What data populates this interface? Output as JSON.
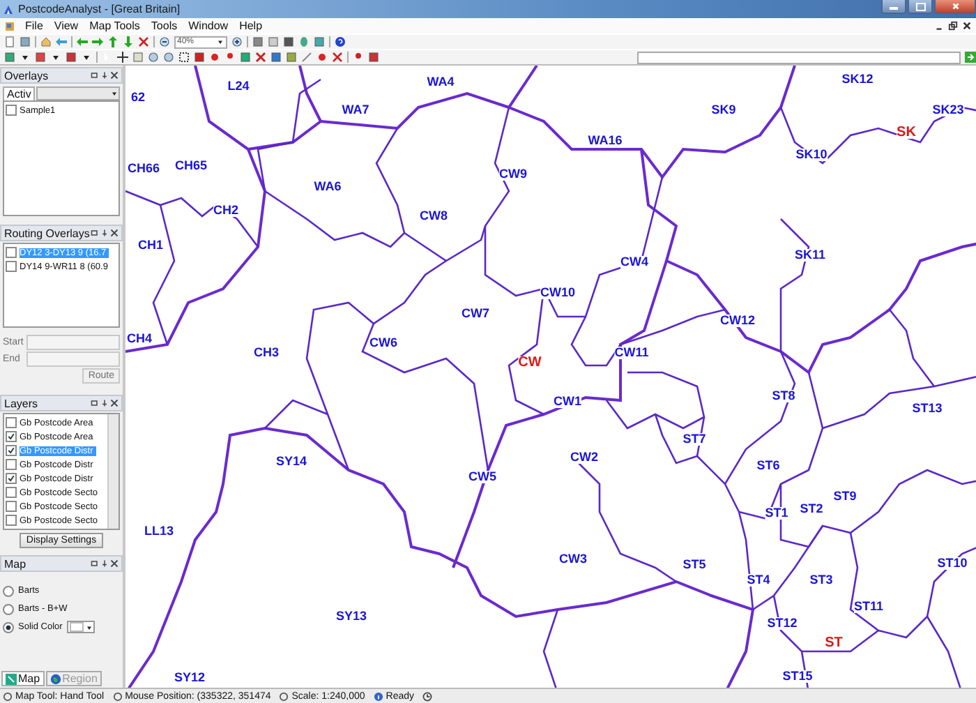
{
  "window": {
    "title": "PostcodeAnalyst - [Great Britain]"
  },
  "menu": [
    "File",
    "View",
    "Map Tools",
    "Tools",
    "Window",
    "Help"
  ],
  "toolbar": {
    "zoom": "40%"
  },
  "overlays": {
    "title": "Overlays",
    "tab": "Activ",
    "items": [
      {
        "label": "Sample1",
        "checked": false
      }
    ]
  },
  "routing_overlays": {
    "title": "Routing Overlays",
    "items": [
      {
        "label": "DY12 3-DY13 9 (16.7",
        "checked": false,
        "selected": true
      },
      {
        "label": "DY14 9-WR11 8 (60.9",
        "checked": false,
        "selected": false
      }
    ],
    "start_label": "Start",
    "end_label": "End",
    "route_button": "Route"
  },
  "layers": {
    "title": "Layers",
    "items": [
      {
        "label": "Gb Postcode Area",
        "checked": false,
        "selected": false
      },
      {
        "label": "Gb Postcode Area",
        "checked": true,
        "selected": false
      },
      {
        "label": "Gb Postcode Distr",
        "checked": true,
        "selected": true
      },
      {
        "label": "Gb Postcode Distr",
        "checked": false,
        "selected": false
      },
      {
        "label": "Gb Postcode Distr",
        "checked": true,
        "selected": false
      },
      {
        "label": "Gb Postcode Secto",
        "checked": false,
        "selected": false
      },
      {
        "label": "Gb Postcode Secto",
        "checked": false,
        "selected": false
      },
      {
        "label": "Gb Postcode Secto",
        "checked": false,
        "selected": false
      }
    ],
    "button": "Display Settings"
  },
  "map_panel": {
    "title": "Map",
    "options": [
      {
        "label": "Barts",
        "selected": false
      },
      {
        "label": "Barts - B+W",
        "selected": false
      },
      {
        "label": "Solid Color",
        "selected": true
      }
    ]
  },
  "panel_tabs": [
    {
      "label": "Map",
      "selected": true
    },
    {
      "label": "Region",
      "selected": false
    }
  ],
  "map": {
    "labels": [
      {
        "text": "L24",
        "kind": "district"
      },
      {
        "text": "WA4",
        "kind": "district"
      },
      {
        "text": "SK12",
        "kind": "district"
      },
      {
        "text": "62",
        "kind": "district"
      },
      {
        "text": "WA7",
        "kind": "district"
      },
      {
        "text": "SK9",
        "kind": "district"
      },
      {
        "text": "SK23",
        "kind": "district"
      },
      {
        "text": "SK",
        "kind": "area"
      },
      {
        "text": "WA16",
        "kind": "district"
      },
      {
        "text": "CH66",
        "kind": "district"
      },
      {
        "text": "CH65",
        "kind": "district"
      },
      {
        "text": "SK10",
        "kind": "district"
      },
      {
        "text": "CW9",
        "kind": "district"
      },
      {
        "text": "WA6",
        "kind": "district"
      },
      {
        "text": "CH2",
        "kind": "district"
      },
      {
        "text": "CW8",
        "kind": "district"
      },
      {
        "text": "SK11",
        "kind": "district"
      },
      {
        "text": "CH1",
        "kind": "district"
      },
      {
        "text": "CW4",
        "kind": "district"
      },
      {
        "text": "CW10",
        "kind": "district"
      },
      {
        "text": "CW7",
        "kind": "district"
      },
      {
        "text": "CW12",
        "kind": "district"
      },
      {
        "text": "CH4",
        "kind": "district"
      },
      {
        "text": "CW6",
        "kind": "district"
      },
      {
        "text": "CH3",
        "kind": "district"
      },
      {
        "text": "CW11",
        "kind": "district"
      },
      {
        "text": "CW",
        "kind": "area"
      },
      {
        "text": "ST8",
        "kind": "district"
      },
      {
        "text": "CW1",
        "kind": "district"
      },
      {
        "text": "ST13",
        "kind": "district"
      },
      {
        "text": "ST7",
        "kind": "district"
      },
      {
        "text": "CW2",
        "kind": "district"
      },
      {
        "text": "ST6",
        "kind": "district"
      },
      {
        "text": "CW5",
        "kind": "district"
      },
      {
        "text": "SY14",
        "kind": "district"
      },
      {
        "text": "ST9",
        "kind": "district"
      },
      {
        "text": "ST1",
        "kind": "district"
      },
      {
        "text": "ST2",
        "kind": "district"
      },
      {
        "text": "LL13",
        "kind": "district"
      },
      {
        "text": "CW3",
        "kind": "district"
      },
      {
        "text": "ST5",
        "kind": "district"
      },
      {
        "text": "ST4",
        "kind": "district"
      },
      {
        "text": "ST3",
        "kind": "district"
      },
      {
        "text": "ST10",
        "kind": "district"
      },
      {
        "text": "ST11",
        "kind": "district"
      },
      {
        "text": "SY13",
        "kind": "district"
      },
      {
        "text": "ST12",
        "kind": "district"
      },
      {
        "text": "ST",
        "kind": "area"
      },
      {
        "text": "ST15",
        "kind": "district"
      },
      {
        "text": "SY12",
        "kind": "district"
      }
    ]
  },
  "status_bar": [
    "Map Tool: Hand Tool",
    "Mouse Position: (335322, 351474",
    "Scale: 1:240,000",
    "Ready"
  ]
}
